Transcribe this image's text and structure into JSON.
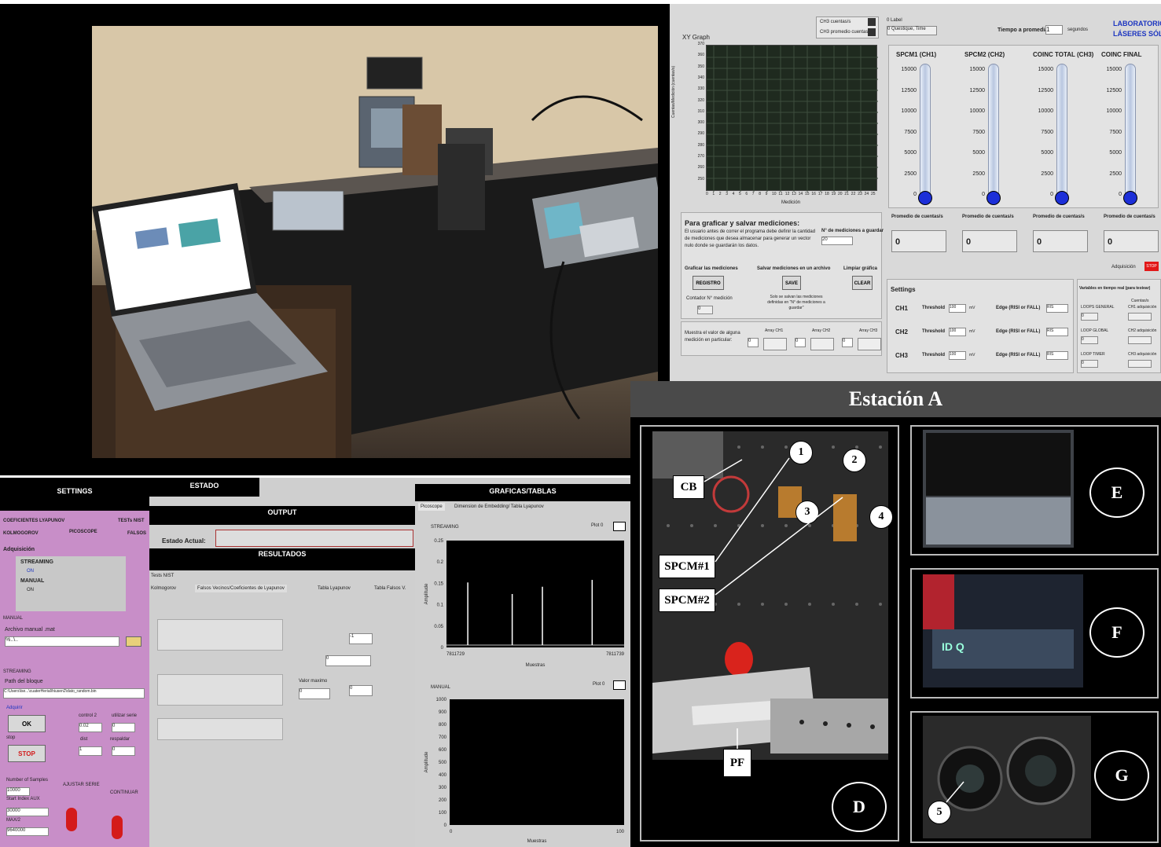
{
  "lv1": {
    "xy_graph_label": "XY Graph",
    "legend": [
      "CH3 cuentas/s",
      "CH3 promedio cuentas/s"
    ],
    "label_field": "0 Label",
    "label_field2": "0 Questique, Time",
    "tiempo_label": "Tiempo a promediar",
    "tiempo_value": "1",
    "tiempo_unit": "segundos",
    "lab_title_1": "LABORATORIO DE",
    "lab_title_2": "LÁSERES SÓLIDOS",
    "yaxis_label": "Cuentas/Medición (cuentas/s)",
    "xaxis_label": "Medición",
    "y_ticks": [
      "370",
      "360",
      "350",
      "340",
      "330",
      "320",
      "310",
      "300",
      "290",
      "280",
      "270",
      "260",
      "250"
    ],
    "x_ticks": [
      "0",
      "1",
      "2",
      "3",
      "4",
      "5",
      "6",
      "7",
      "8",
      "9",
      "10",
      "11",
      "12",
      "13",
      "14",
      "15",
      "16",
      "17",
      "18",
      "19",
      "20",
      "21",
      "22",
      "23",
      "24",
      "25"
    ],
    "channels": [
      {
        "title": "SPCM1 (CH1)",
        "promedio_label": "Promedio de cuentas/s",
        "promedio_value": "0"
      },
      {
        "title": "SPCM2 (CH2)",
        "promedio_label": "Promedio de cuentas/s",
        "promedio_value": "0"
      },
      {
        "title": "COINC TOTAL (CH3)",
        "promedio_label": "Promedio de cuentas/s",
        "promedio_value": "0"
      },
      {
        "title": "COINC FINAL",
        "promedio_label": "Promedio de cuentas/s",
        "promedio_value": "0"
      }
    ],
    "therm_ticks": [
      "15000",
      "12500",
      "10000",
      "7500",
      "5000",
      "2500",
      "0"
    ],
    "graficar_title": "Para graficar y salvar mediciones:",
    "graficar_desc": "El usuario antes de correr el programa debe definir la cantidad de mediciones que desea almacenar para generar un vector nulo donde se guardarán los datos.",
    "n_mediciones_label": "N° de mediciones a guardar",
    "n_mediciones_value": "20",
    "graficar_label": "Graficar las mediciones",
    "salvar_label": "Salvar mediciones en un archivo",
    "limpiar_label": "Limpiar gráfica",
    "registro_btn": "REGISTRO",
    "save_btn": "SAVE",
    "clear_btn": "CLEAR",
    "contador_label": "Contador N° medición",
    "contador_value": "0",
    "save_note": "Solo se salvan las mediciones definidas en \"N° de mediciones a guardar\"",
    "muestra_label": "Muestra el valor de alguna medición en particular:",
    "array_labels": [
      "Array CH1",
      "Array CH2",
      "Array CH3"
    ],
    "array_index": "0",
    "adquisicion_label": "Adquisición",
    "adquisicion_btn": "STOP",
    "settings_title": "Settings",
    "settings_rows": [
      {
        "ch": "CH1",
        "threshold_label": "Threshold",
        "threshold_value": "100",
        "unit": "mV",
        "edge_label": "Edge (RISI or FALL)",
        "edge_value": "RIS"
      },
      {
        "ch": "CH2",
        "threshold_label": "Threshold",
        "threshold_value": "100",
        "unit": "mV",
        "edge_label": "Edge (RISI or FALL)",
        "edge_value": "RIS"
      },
      {
        "ch": "CH3",
        "threshold_label": "Threshold",
        "threshold_value": "100",
        "unit": "mV",
        "edge_label": "Edge (RISI or FALL)",
        "edge_value": "RIS"
      }
    ],
    "variables_title": "Variables en tiempo real (para testear)",
    "loops": [
      "LOOPS GENERAL",
      "LOOP GLOBAL",
      "LOOP TIMER"
    ],
    "loop_value": "0",
    "cuentas_label": "Cuentas/s",
    "ch_adq": [
      "CH1 adquisición",
      "CH2 adquisición",
      "CH3 adquisición"
    ]
  },
  "est": {
    "title": "Estación A",
    "labels": {
      "cb": "CB",
      "spcm1": "SPCM#1",
      "spcm2": "SPCM#2",
      "pf": "PF"
    },
    "numbers": [
      "1",
      "2",
      "3",
      "4",
      "5"
    ],
    "panel_letters": [
      "D",
      "E",
      "F",
      "G"
    ],
    "device_text": "ID Q"
  },
  "lv2": {
    "settings_header": "SETTINGS",
    "estado_header": "ESTADO",
    "graficas_header": "GRAFICAS/TABLAS",
    "tabs_left": [
      "COEFICIENTES LYAPUNOV",
      "TESTs NIST",
      "KOLMOGOROV",
      "PICOSCOPE",
      "FALSOS"
    ],
    "adquisicion": "Adquisición",
    "streaming": "STREAMING",
    "on1": "ON",
    "manual": "MANUAL",
    "on2": "ON",
    "manual_box": "MANUAL",
    "archivo_label": "Archivo manual .mat",
    "archivo_value": "%..\\..",
    "streaming_box": "STREAMING",
    "path_label": "Path del bloque",
    "path_value": "C:\\Users\\lse...\\cuaterHerial\\hiusen2\\dato_random.bin",
    "adquirir": "Adquirir",
    "ok_btn": "OK",
    "stop_label": "stop",
    "stop_btn": "STOP",
    "control2_label": "control 2",
    "control2_value": "0.02",
    "utilizar_label": "utilizar serie",
    "utilizar_value": "0",
    "dist_label": "dist",
    "dist_value": "1",
    "respaldar_label": "respaldar",
    "respaldar_value": "0",
    "samples_label": "Number of Samples",
    "samples_value": "10000",
    "start_label": "Start Index AUX",
    "start_value": "30000",
    "max_label": "MAX/2",
    "max_value": "9640000",
    "ajustar_label": "AJUSTAR SERIE",
    "continuar_label": "CONTINUAR",
    "output_header": "OUTPUT",
    "estado_actual_label": "Estado Actual:",
    "resultados_header": "RESULTADOS",
    "tests_nist": "Tests NIST",
    "tabs_mid": [
      "Kolmogorov",
      "Falsos Vecinos/Coeficientes de Lyapunov",
      "Tabla Lyapunov",
      "Tabla Falsos V."
    ],
    "val1": "-1",
    "val2": "0",
    "valor_maximo_label": "Valor maximo",
    "valor_maximo_value": "0",
    "val3": "0",
    "tabs_right": [
      "Picoscope",
      "Dimension de Embedding/ Tabla Lyapunov"
    ],
    "plot_label": "Plot 0"
  },
  "chart_data": [
    {
      "type": "line",
      "title": "STREAMING",
      "xlabel": "Muestras",
      "ylabel": "Amplitude",
      "ylim": [
        0,
        0.25
      ],
      "y_ticks": [
        "0.25",
        "0.2",
        "0.15",
        "0.1",
        "0.05",
        "0"
      ],
      "x_ticks": [
        "7811729",
        "7811739"
      ],
      "spikes": [
        {
          "x": 0.12,
          "y": 0.152
        },
        {
          "x": 0.37,
          "y": 0.125
        },
        {
          "x": 0.54,
          "y": 0.142
        },
        {
          "x": 0.82,
          "y": 0.158
        }
      ]
    },
    {
      "type": "line",
      "title": "MANUAL",
      "xlabel": "Muestras",
      "ylabel": "Amplitude",
      "ylim": [
        0,
        1000
      ],
      "y_ticks": [
        "1000",
        "900",
        "800",
        "700",
        "600",
        "500",
        "400",
        "300",
        "200",
        "100",
        "0"
      ],
      "x_ticks": [
        "0",
        "100"
      ]
    }
  ]
}
